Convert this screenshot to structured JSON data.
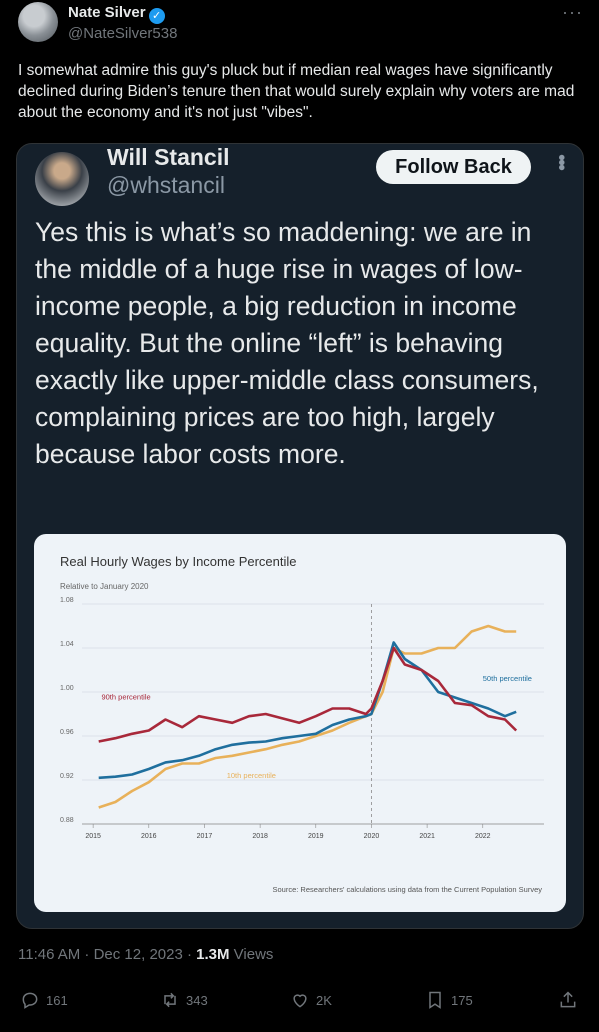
{
  "post": {
    "author_name": "Nate Silver",
    "author_handle": "@NateSilver538",
    "text": "I somewhat admire this guy's pluck but if median real wages have significantly declined during Biden’s tenure then that would surely explain why voters are mad about the economy and it's not just \"vibes\".",
    "more_glyph": "···"
  },
  "quoted": {
    "author_name": "Will Stancil",
    "author_handle": "@whstancil",
    "follow_label": "Follow Back",
    "text": "Yes this is what’s so maddening: we are in the middle of a huge rise in wages of low-income people, a big reduction in income equality. But the online “left” is behaving exactly like upper-middle class consumers, complaining prices are too high, largely because labor costs more."
  },
  "footer": {
    "time": "11:46 AM · Dec 12, 2023 · ",
    "views_count": "1.3M",
    "views_label": " Views",
    "replies": "161",
    "reposts": "343",
    "likes": "2K",
    "bookmarks": "175"
  },
  "colors": {
    "p90": "#a8283a",
    "p50": "#1f6f9e",
    "p10": "#e8b15a",
    "card_bg": "#eef3f8"
  },
  "chart_data": {
    "type": "line",
    "title": "Real Hourly Wages by Income Percentile",
    "subtitle": "Relative to January 2020",
    "source": "Source: Researchers' calculations using data from the Current Population Survey",
    "ylim": [
      0.88,
      1.08
    ],
    "yticks": [
      "1.08",
      "1.04",
      "1.00",
      "0.96",
      "0.92",
      "0.88"
    ],
    "xticks": [
      "2015",
      "2016",
      "2017",
      "2018",
      "2019",
      "2020",
      "2021",
      "2022"
    ],
    "x": [
      2015.1,
      2015.4,
      2015.7,
      2016.0,
      2016.3,
      2016.6,
      2016.9,
      2017.2,
      2017.5,
      2017.8,
      2018.1,
      2018.4,
      2018.7,
      2019.0,
      2019.3,
      2019.6,
      2019.9,
      2020.0,
      2020.2,
      2020.4,
      2020.6,
      2020.9,
      2021.2,
      2021.5,
      2021.8,
      2022.1,
      2022.4,
      2022.6
    ],
    "series": [
      {
        "name": "90th percentile",
        "values": [
          0.955,
          0.958,
          0.962,
          0.965,
          0.975,
          0.968,
          0.978,
          0.975,
          0.972,
          0.978,
          0.98,
          0.976,
          0.972,
          0.978,
          0.985,
          0.985,
          0.98,
          0.985,
          1.01,
          1.04,
          1.025,
          1.02,
          1.01,
          0.99,
          0.988,
          0.978,
          0.975,
          0.965
        ]
      },
      {
        "name": "50th percentile",
        "values": [
          0.922,
          0.923,
          0.925,
          0.93,
          0.936,
          0.938,
          0.942,
          0.948,
          0.952,
          0.954,
          0.955,
          0.958,
          0.96,
          0.962,
          0.97,
          0.975,
          0.978,
          0.98,
          1.01,
          1.045,
          1.03,
          1.02,
          1.0,
          0.995,
          0.99,
          0.985,
          0.978,
          0.982
        ]
      },
      {
        "name": "10th percentile",
        "values": [
          0.895,
          0.9,
          0.91,
          0.918,
          0.93,
          0.935,
          0.935,
          0.94,
          0.942,
          0.945,
          0.948,
          0.952,
          0.955,
          0.96,
          0.965,
          0.972,
          0.978,
          0.98,
          1.0,
          1.04,
          1.035,
          1.035,
          1.04,
          1.04,
          1.055,
          1.06,
          1.055,
          1.055
        ]
      }
    ],
    "legend": "inline labels",
    "grid": true
  }
}
